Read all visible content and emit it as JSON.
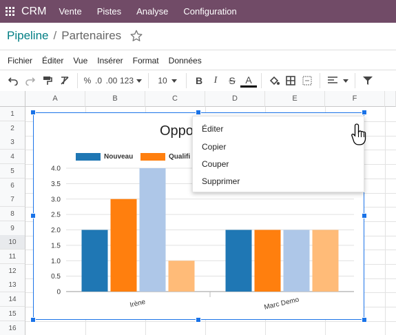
{
  "topnav": {
    "brand": "CRM",
    "items": [
      "Vente",
      "Pistes",
      "Analyse",
      "Configuration"
    ]
  },
  "breadcrumb": {
    "parent": "Pipeline",
    "separator": "/",
    "current": "Partenaires"
  },
  "menubar": [
    "Fichier",
    "Éditer",
    "Vue",
    "Insérer",
    "Format",
    "Données"
  ],
  "toolbar": {
    "percent": "%",
    "dec_decrease": ".0",
    "dec_increase": ".00",
    "number_format": "123",
    "font_size": "10",
    "bold": "B",
    "italic": "I",
    "strike": "S",
    "text_color": "A"
  },
  "sheet": {
    "columns": [
      "A",
      "B",
      "C",
      "D",
      "E",
      "F"
    ],
    "rows": [
      "1",
      "2",
      "3",
      "4",
      "5",
      "6",
      "7",
      "8",
      "9",
      "10",
      "11",
      "12",
      "13",
      "14",
      "15",
      "16"
    ],
    "selected_row": "10"
  },
  "chart_data": {
    "type": "bar",
    "title": "Oppo",
    "categories": [
      "Irène",
      "Marc Demo"
    ],
    "series": [
      {
        "name": "Nouveau",
        "values": [
          2,
          2
        ],
        "color": "#1f77b4"
      },
      {
        "name": "Qualifié",
        "values": [
          3,
          2
        ],
        "color": "#ff7f0e"
      },
      {
        "name": "",
        "values": [
          4,
          2
        ],
        "color": "#aec7e8"
      },
      {
        "name": "",
        "values": [
          1,
          2
        ],
        "color": "#ffbb78"
      }
    ],
    "ylim": [
      0,
      4
    ],
    "yticks": [
      "0",
      "0.5",
      "1.0",
      "1.5",
      "2.0",
      "2.5",
      "3.0",
      "3.5",
      "4.0"
    ],
    "legend_labels": [
      "Nouveau",
      "Qualifi"
    ],
    "grid": true,
    "legend_position": "top"
  },
  "chart_menu": {
    "items": [
      "Éditer",
      "Copier",
      "Couper",
      "Supprimer"
    ]
  },
  "colors": {
    "topnav": "#714b67",
    "link": "#017e84",
    "selection": "#1a73e8"
  }
}
